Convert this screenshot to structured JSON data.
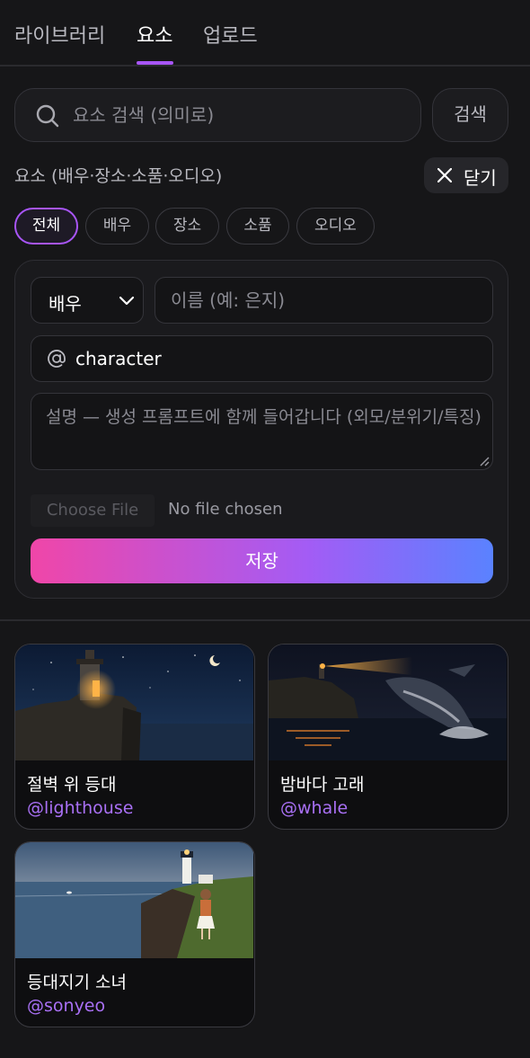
{
  "tabs": [
    {
      "label": "라이브러리"
    },
    {
      "label": "요소"
    },
    {
      "label": "업로드"
    }
  ],
  "active_tab": "요소",
  "search": {
    "placeholder": "요소 검색 (의미로)",
    "button_label": "검색"
  },
  "section": {
    "label": "요소 (배우·장소·소품·오디오)",
    "close_label": "닫기"
  },
  "filters": [
    {
      "label": "전체",
      "active": true
    },
    {
      "label": "배우"
    },
    {
      "label": "장소"
    },
    {
      "label": "소품"
    },
    {
      "label": "오디오"
    }
  ],
  "form": {
    "type_value": "배우",
    "name_placeholder": "이름 (예: 은지)",
    "handle_value": "character",
    "description_placeholder": "설명 — 생성 프롬프트에 함께 들어갑니다 (외모/분위기/특징)",
    "file_button": "Choose File",
    "file_status": "No file chosen",
    "save_label": "저장"
  },
  "elements": [
    {
      "title": "절벽 위 등대",
      "handle": "@lighthouse",
      "image": "lighthouse on cliff at night"
    },
    {
      "title": "밤바다 고래",
      "handle": "@whale",
      "image": "whale breaching at night"
    },
    {
      "title": "등대지기 소녀",
      "handle": "@sonyeo",
      "image": "girl near lighthouse at dusk"
    }
  ],
  "colors": {
    "accent": "#a855f7",
    "background": "#161618",
    "handle_text": "#a970f5",
    "save_gradient": [
      "#f046a8",
      "#a35cf5",
      "#5a82ff"
    ]
  },
  "icons": [
    "search-icon",
    "close-icon",
    "chevron-down-icon",
    "at-icon"
  ]
}
